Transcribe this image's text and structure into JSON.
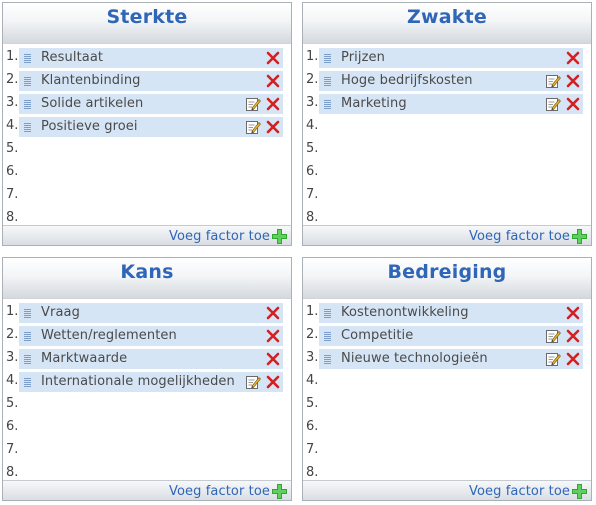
{
  "panels": [
    {
      "title": "Sterkte",
      "add_label": "Voeg factor toe",
      "row_numbers": [
        "1.",
        "2.",
        "3.",
        "4.",
        "5.",
        "6.",
        "7.",
        "8."
      ],
      "items": [
        {
          "label": "Resultaat",
          "editable": false
        },
        {
          "label": "Klantenbinding",
          "editable": false
        },
        {
          "label": "Solide artikelen",
          "editable": true
        },
        {
          "label": "Positieve groei",
          "editable": true
        }
      ]
    },
    {
      "title": "Zwakte",
      "add_label": "Voeg factor toe",
      "row_numbers": [
        "1.",
        "2.",
        "3.",
        "4.",
        "5.",
        "6.",
        "7.",
        "8."
      ],
      "items": [
        {
          "label": "Prijzen",
          "editable": false
        },
        {
          "label": "Hoge bedrijfskosten",
          "editable": true
        },
        {
          "label": "Marketing",
          "editable": true
        }
      ]
    },
    {
      "title": "Kans",
      "add_label": "Voeg factor toe",
      "row_numbers": [
        "1.",
        "2.",
        "3.",
        "4.",
        "5.",
        "6.",
        "7.",
        "8."
      ],
      "items": [
        {
          "label": "Vraag",
          "editable": false
        },
        {
          "label": "Wetten/reglementen",
          "editable": false
        },
        {
          "label": "Marktwaarde",
          "editable": false
        },
        {
          "label": "Internationale mogelijkheden",
          "editable": true
        }
      ]
    },
    {
      "title": "Bedreiging",
      "add_label": "Voeg factor toe",
      "row_numbers": [
        "1.",
        "2.",
        "3.",
        "4.",
        "5.",
        "6.",
        "7.",
        "8."
      ],
      "items": [
        {
          "label": "Kostenontwikkeling",
          "editable": false
        },
        {
          "label": "Competitie",
          "editable": true
        },
        {
          "label": "Nieuwe technologieën",
          "editable": true
        }
      ]
    }
  ],
  "colors": {
    "title": "#2f66b8",
    "item_background": "#d6e5f5",
    "delete_icon": "#d42020",
    "add_icon": "#2fa82f"
  },
  "icons": {
    "drag": "drag-handle-icon",
    "edit": "edit-note-icon",
    "delete": "delete-x-icon",
    "add": "plus-icon"
  }
}
